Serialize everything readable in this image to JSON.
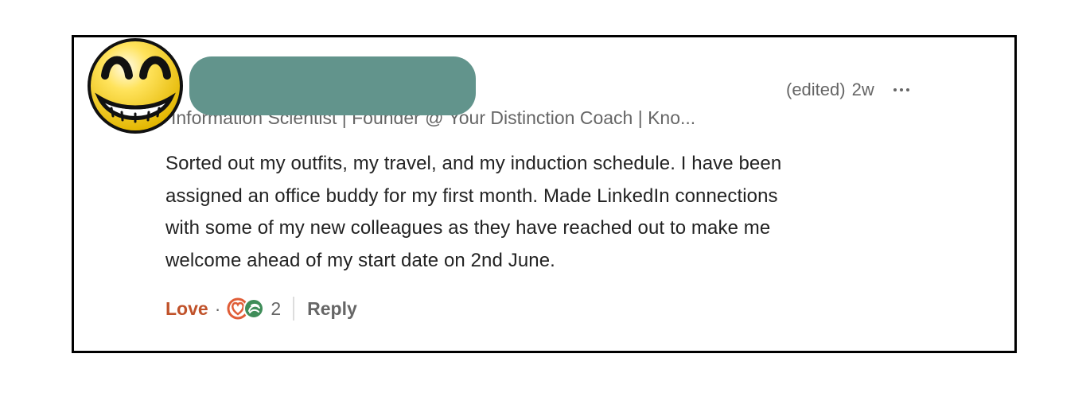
{
  "comment": {
    "headline": "Information Scientist | Founder @ Your Distinction Coach | Kno...",
    "edited_label": "(edited)",
    "timestamp": "2w",
    "body_lines": [
      "Sorted out my outfits, my travel, and my induction schedule. I have been",
      "assigned an office buddy for my first month. Made LinkedIn connections",
      "with some of my new colleagues as they have reached out to make me",
      "welcome ahead of my start date on 2nd June."
    ]
  },
  "actions": {
    "reaction_label": "Love",
    "separator": "·",
    "reaction_count": "2",
    "reply_label": "Reply",
    "reaction_icons": [
      "love-reaction-icon",
      "support-reaction-icon"
    ]
  },
  "colors": {
    "redaction": "#62948c",
    "love": "#c0522a",
    "muted_text": "#666666",
    "body_text": "#222222"
  }
}
